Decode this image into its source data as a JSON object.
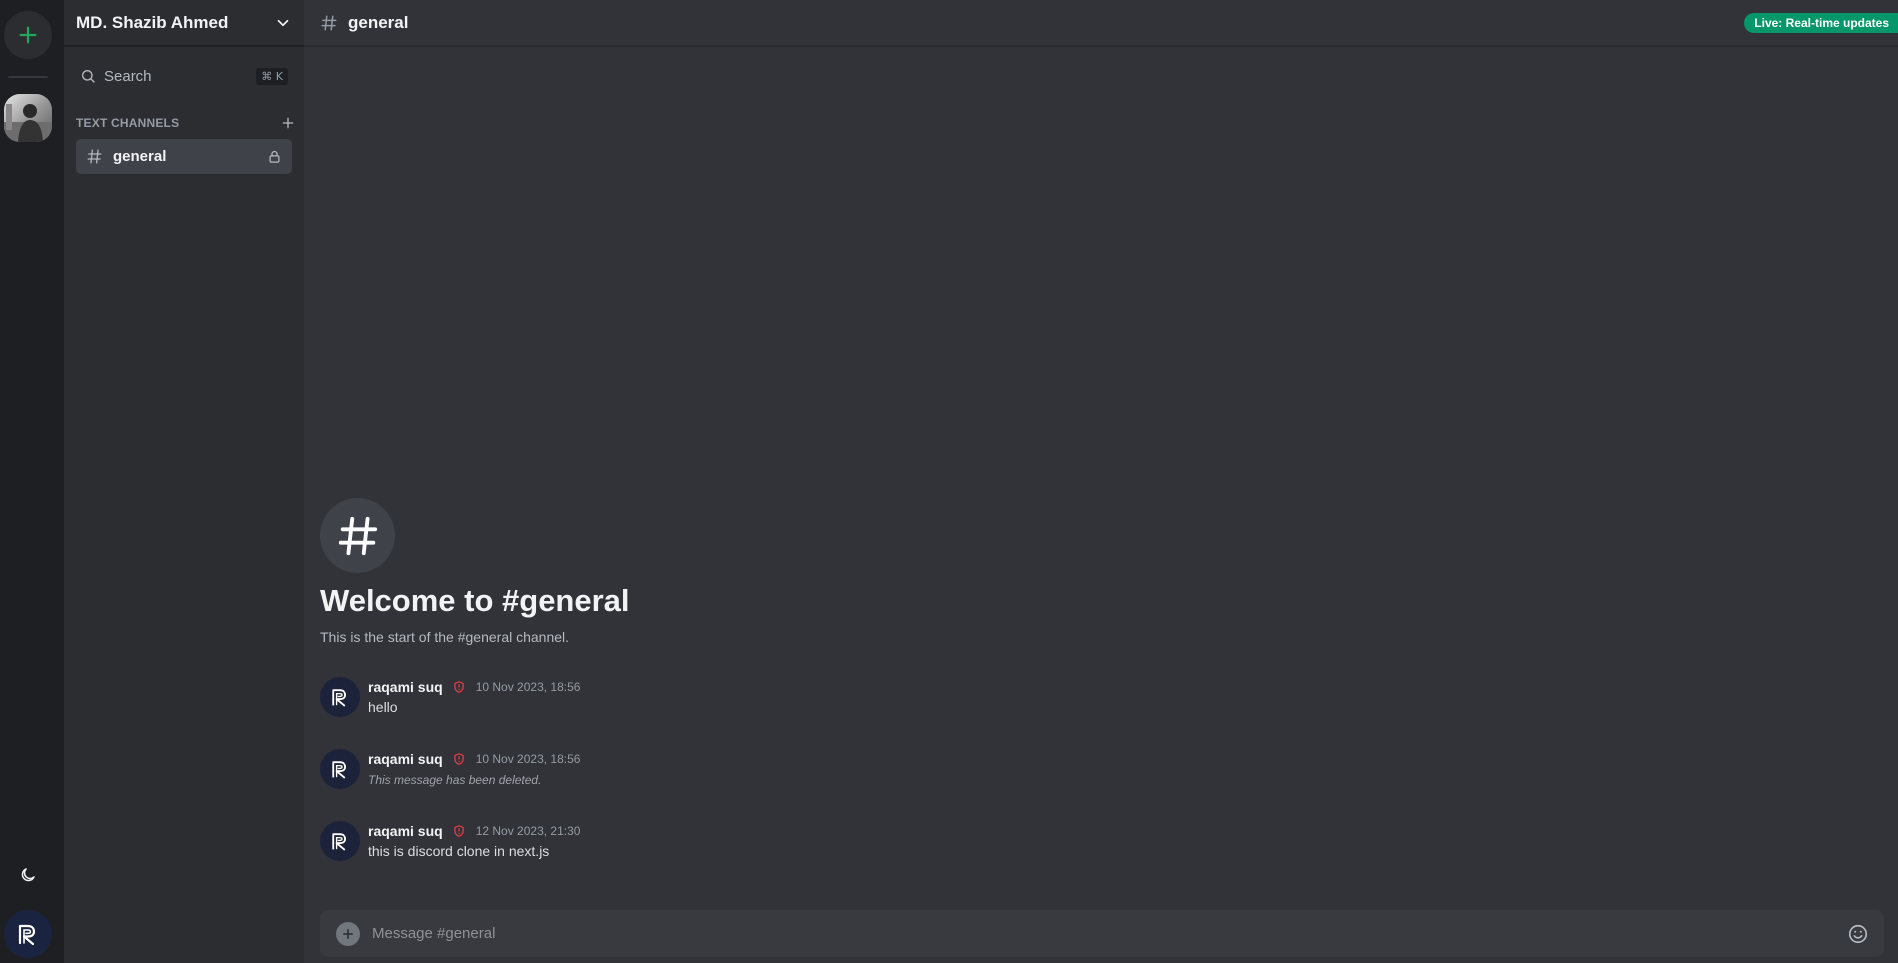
{
  "server": {
    "name": "MD. Shazib Ahmed"
  },
  "search": {
    "label": "Search",
    "shortcut": "⌘ K"
  },
  "sections": {
    "text_channels": "TEXT CHANNELS"
  },
  "channels": [
    {
      "name": "general",
      "locked": true,
      "active": true
    }
  ],
  "header": {
    "channel": "general",
    "live_badge": "Live: Real-time updates"
  },
  "welcome": {
    "title": "Welcome to #general",
    "subtitle": "This is the start of the #general channel."
  },
  "messages": [
    {
      "author": "raqami suq",
      "timestamp": "10 Nov 2023, 18:56",
      "text": "hello",
      "deleted": false
    },
    {
      "author": "raqami suq",
      "timestamp": "10 Nov 2023, 18:56",
      "text": "This message has been deleted.",
      "deleted": true
    },
    {
      "author": "raqami suq",
      "timestamp": "12 Nov 2023, 21:30",
      "text": "this is discord clone in next.js",
      "deleted": false
    }
  ],
  "composer": {
    "placeholder": "Message #general"
  },
  "icons": {
    "rail_add": "plus-icon",
    "theme": "moon-icon",
    "search": "search-icon",
    "chevron": "chevron-down-icon",
    "lock": "lock-icon",
    "role": "shield-alert-icon",
    "emoji": "smile-icon"
  },
  "colors": {
    "accent_green": "#23a55a",
    "live_badge": "#059669",
    "role_admin": "#f23f43"
  }
}
